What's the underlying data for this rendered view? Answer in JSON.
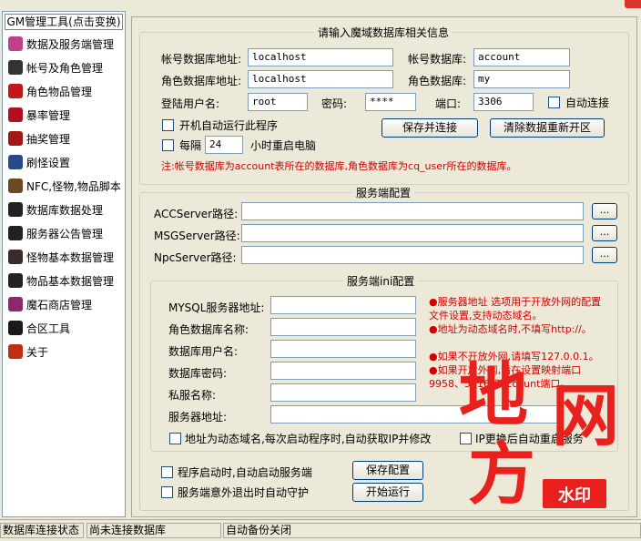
{
  "sidebar": {
    "header": "GM管理工具(点击变换)",
    "items": [
      {
        "label": "数据及服务端管理",
        "icon": "pink-gem-icon",
        "color": "#c0408a"
      },
      {
        "label": "帐号及角色管理",
        "icon": "character-icon",
        "color": "#333333"
      },
      {
        "label": "角色物品管理",
        "icon": "red-potion-icon",
        "color": "#c01818"
      },
      {
        "label": "暴率管理",
        "icon": "red-creature-icon",
        "color": "#b01020"
      },
      {
        "label": "抽奖管理",
        "icon": "chest-icon",
        "color": "#a01818"
      },
      {
        "label": "刷怪设置",
        "icon": "blue-warrior-icon",
        "color": "#244a8c"
      },
      {
        "label": "NFC,怪物,物品脚本",
        "icon": "scroll-icon",
        "color": "#6a4a20"
      },
      {
        "label": "数据库数据处理",
        "icon": "dark-beast-icon",
        "color": "#222222"
      },
      {
        "label": "服务器公告管理",
        "icon": "black-bird-icon",
        "color": "#222222"
      },
      {
        "label": "怪物基本数据管理",
        "icon": "dark-monster-icon",
        "color": "#3a2a2a"
      },
      {
        "label": "物品基本数据管理",
        "icon": "spider-icon",
        "color": "#222222"
      },
      {
        "label": "魔石商店管理",
        "icon": "colored-figure-icon",
        "color": "#8a2a6a"
      },
      {
        "label": "合区工具",
        "icon": "dark-blob-icon",
        "color": "#1a1a1a"
      },
      {
        "label": "关于",
        "icon": "red-figure-icon",
        "color": "#c03010"
      }
    ]
  },
  "db": {
    "legend": "请输入魔域数据库相关信息",
    "account_addr_label": "帐号数据库地址:",
    "account_addr_value": "localhost",
    "account_db_label": "帐号数据库:",
    "account_db_value": "account",
    "role_addr_label": "角色数据库地址:",
    "role_addr_value": "localhost",
    "role_db_label": "角色数据库:",
    "role_db_value": "my",
    "user_label": "登陆用户名:",
    "user_value": "root",
    "pwd_label": "密码:",
    "pwd_value": "****",
    "port_label": "端口:",
    "port_value": "3306",
    "auto_connect_label": "自动连接",
    "autorun_label": "开机自动运行此程序",
    "every_label": "每隔",
    "every_value": "24",
    "hours_label": "小时重启电脑",
    "save_connect_btn": "保存并连接",
    "clear_btn": "清除数据重新开区",
    "note": "注:帐号数据库为account表所在的数据库,角色数据库为cq_user所在的数据库。"
  },
  "server": {
    "legend": "服务端配置",
    "acc_label": "ACCServer路径:",
    "msg_label": "MSGServer路径:",
    "npc_label": "NpcServer路径:",
    "browse": "...",
    "ini_legend": "服务端ini配置",
    "mysql_addr_label": "MYSQL服务器地址:",
    "role_db_name_label": "角色数据库名称:",
    "db_user_label": "数据库用户名:",
    "db_pwd_label": "数据库密码:",
    "private_name_label": "私服名称:",
    "server_addr_label": "服务器地址:",
    "notes": [
      "●服务器地址 选项用于开放外网的配置文件设置,支持动态域名。",
      "●地址为动态域名时,不填写http://。",
      "●如果不开放外网,请填写127.0.0.1。",
      "●如果开放外网,请在设置映射端口9958、5816和Account端口。"
    ],
    "dynamic_domain_label": "地址为动态域名,每次启动程序时,自动获取IP并修改",
    "ip_change_label": "IP更换后自动重启服务",
    "save_config_btn": "保存配置",
    "auto_start_label": "程序启动时,自动启动服务端",
    "guard_label": "服务端意外退出时自动守护",
    "start_btn": "开始运行"
  },
  "status": {
    "db_status": "数据库连接状态",
    "not_connected": "尚未连接数据库",
    "backup": "自动备份关闭"
  },
  "watermark": {
    "chars": [
      "地",
      "网",
      "方"
    ],
    "tag": "水印",
    "color": "#e8201e"
  }
}
